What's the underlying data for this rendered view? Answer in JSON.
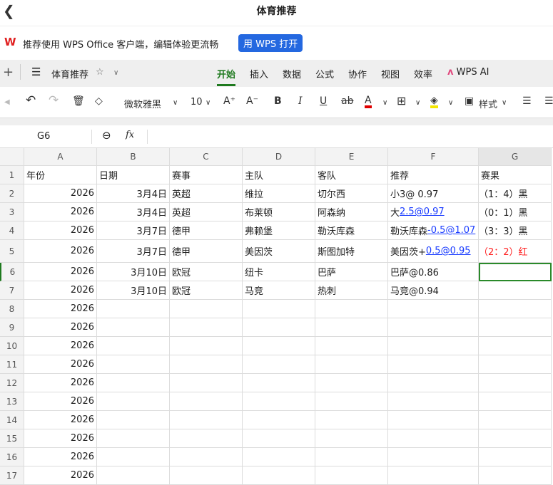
{
  "window": {
    "title": "体育推荐",
    "back_icon": "chevron-left-icon"
  },
  "banner": {
    "text": "推荐使用 WPS Office 客户端，编辑体验更流畅",
    "button": "用 WPS 打开"
  },
  "doc": {
    "name": "体育推荐"
  },
  "tabs": [
    "开始",
    "插入",
    "数据",
    "公式",
    "协作",
    "视图",
    "效率",
    "WPS AI"
  ],
  "active_tab": "开始",
  "accent": "#1f7a1f",
  "toolbar": {
    "font": "微软雅黑",
    "size": "10",
    "style": "样式",
    "font_color": "#e00000",
    "fill_color": "#f5e600"
  },
  "formula_bar": {
    "cell_ref": "G6",
    "fx": "fx",
    "value": ""
  },
  "columns": [
    "A",
    "B",
    "C",
    "D",
    "E",
    "F",
    "G"
  ],
  "rows": [
    {
      "n": "1",
      "cells": [
        "年份",
        "日期",
        "赛事",
        "主队",
        "客队",
        "推荐",
        "赛果"
      ]
    },
    {
      "n": "2",
      "cells": [
        "2026",
        "3月4日",
        "英超",
        "维拉",
        "切尔西",
        [
          [
            "小3@ 0.97",
            false
          ]
        ],
        "（1：4）黑"
      ]
    },
    {
      "n": "3",
      "cells": [
        "2026",
        "3月4日",
        "英超",
        "布莱顿",
        "阿森纳",
        [
          [
            "大",
            false
          ],
          [
            "2.5@0.97",
            true
          ]
        ],
        "（0：1）黑"
      ]
    },
    {
      "n": "4",
      "cells": [
        "2026",
        "3月7日",
        "德甲",
        "弗赖堡",
        "勒沃库森",
        [
          [
            "勒沃库森",
            false
          ],
          [
            "-0.5@1.07",
            true
          ]
        ],
        "（3：3）黑"
      ]
    },
    {
      "n": "5",
      "cells": [
        "2026",
        "3月7日",
        "德甲",
        "美因茨",
        "斯图加特",
        [
          [
            "美因茨+",
            false
          ],
          [
            "0.5@0.95",
            true
          ]
        ],
        "（2：2）红"
      ]
    },
    {
      "n": "6",
      "cells": [
        "2026",
        "3月10日",
        "欧冠",
        "纽卡",
        "巴萨",
        [
          [
            "巴萨@0.86",
            false
          ]
        ],
        ""
      ]
    },
    {
      "n": "7",
      "cells": [
        "2026",
        "3月10日",
        "欧冠",
        "马竞",
        "热刺",
        [
          [
            "马竞@0.94",
            false
          ]
        ],
        ""
      ]
    },
    {
      "n": "8",
      "cells": [
        "2026",
        "",
        "",
        "",
        "",
        "",
        ""
      ]
    },
    {
      "n": "9",
      "cells": [
        "2026",
        "",
        "",
        "",
        "",
        "",
        ""
      ]
    },
    {
      "n": "10",
      "cells": [
        "2026",
        "",
        "",
        "",
        "",
        "",
        ""
      ]
    },
    {
      "n": "11",
      "cells": [
        "2026",
        "",
        "",
        "",
        "",
        "",
        ""
      ]
    },
    {
      "n": "12",
      "cells": [
        "2026",
        "",
        "",
        "",
        "",
        "",
        ""
      ]
    },
    {
      "n": "13",
      "cells": [
        "2026",
        "",
        "",
        "",
        "",
        "",
        ""
      ]
    },
    {
      "n": "14",
      "cells": [
        "2026",
        "",
        "",
        "",
        "",
        "",
        ""
      ]
    },
    {
      "n": "15",
      "cells": [
        "2026",
        "",
        "",
        "",
        "",
        "",
        ""
      ]
    },
    {
      "n": "16",
      "cells": [
        "2026",
        "",
        "",
        "",
        "",
        "",
        ""
      ]
    },
    {
      "n": "17",
      "cells": [
        "2026",
        "",
        "",
        "",
        "",
        "",
        ""
      ]
    }
  ],
  "red_text": "#ff2020",
  "selected_cell": "G6"
}
